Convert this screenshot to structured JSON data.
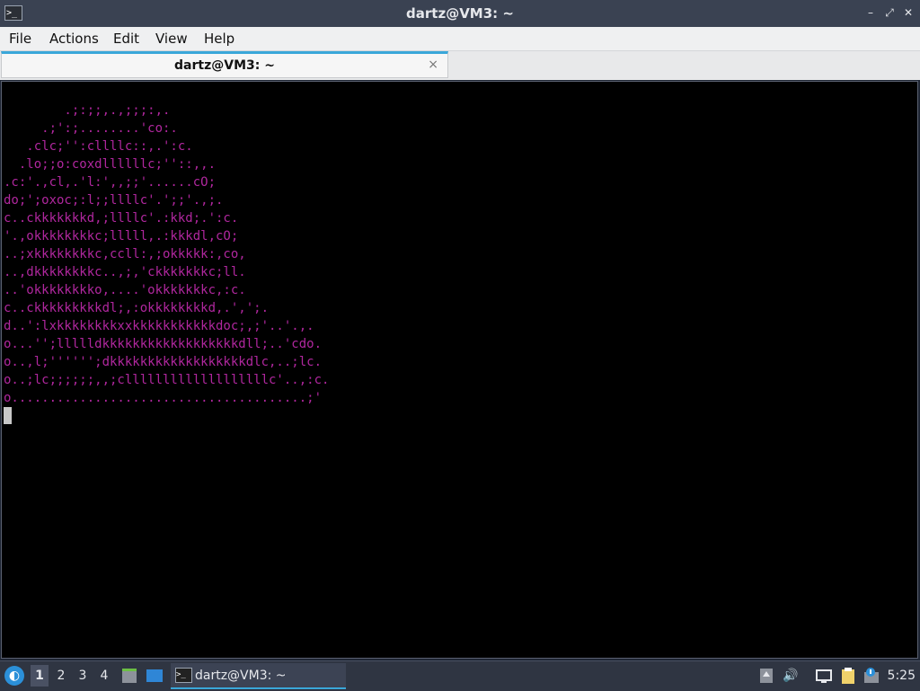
{
  "window": {
    "title": "dartz@VM3: ~",
    "app_icon": "terminal-icon",
    "controls": {
      "minimize": "–",
      "restore": "⤢",
      "close": "✕"
    }
  },
  "menubar": {
    "items": [
      "File",
      "Actions",
      "Edit",
      "View",
      "Help"
    ]
  },
  "tab": {
    "title": "dartz@VM3: ~",
    "close": "×"
  },
  "terminal": {
    "text_color": "#b0279e",
    "background": "#000000",
    "lines": [
      "        .;:;;,.,;;;:,.",
      "     .;':;........'co:.",
      "   .clc;'':cllllc::,.':c.",
      "  .lo;;o:coxdllllllc;''::,,.",
      ".c:'.,cl,.'l:',,;;'......cO;",
      "do;';oxoc;:l;;llllc'.';;'.,;.",
      "c..ckkkkkkkd,;llllc'.:kkd;.':c.",
      "'.,okkkkkkkkc;lllll,.:kkkdl,cO;",
      "..;xkkkkkkkkc,ccll:,;okkkkk:,co,",
      "..,dkkkkkkkkc..,;,'ckkkkkkkc;ll.",
      "..'okkkkkkkko,....'okkkkkkkc,:c.",
      "c..ckkkkkkkkkdl;,:okkkkkkkkd,.',';.",
      "d..':lxkkkkkkkkxxkkkkkkkkkkkdoc;,;'..'.,.",
      "o...'';llllldkkkkkkkkkkkkkkkkkkdll;..'cdo.",
      "o..,l;'''''';dkkkkkkkkkkkkkkkkkkdlc,..;lc.",
      "o..;lc;;;;;;,,;clllllllllllllllllllc'..,:c.",
      "o.......................................;'"
    ]
  },
  "taskbar": {
    "start_icon": "lxqt-start-icon",
    "workspaces": [
      "1",
      "2",
      "3",
      "4"
    ],
    "active_workspace": "1",
    "task": {
      "label": "dartz@VM3: ~"
    },
    "clock": "5:25",
    "tray_icons": [
      "tray-arrow-icon",
      "volume-icon",
      "network-icon",
      "clipboard-icon",
      "notification-icon"
    ]
  }
}
